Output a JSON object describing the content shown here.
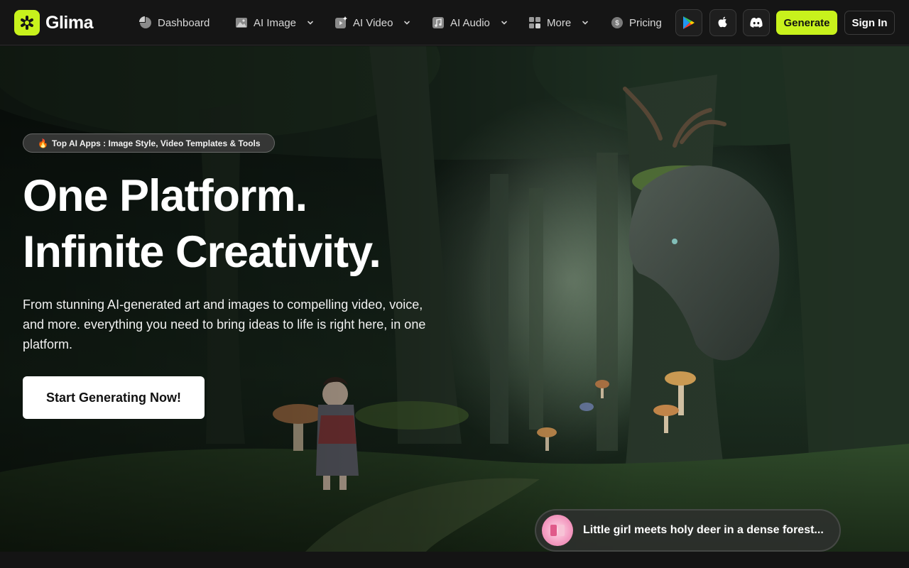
{
  "brand": {
    "name": "Glima",
    "accent": "#c8f21c"
  },
  "nav": {
    "items": [
      {
        "label": "Dashboard",
        "icon": "dashboard-icon",
        "has_dropdown": false
      },
      {
        "label": "AI Image",
        "icon": "image-icon",
        "has_dropdown": true
      },
      {
        "label": "AI Video",
        "icon": "video-icon",
        "has_dropdown": true
      },
      {
        "label": "AI Audio",
        "icon": "audio-icon",
        "has_dropdown": true
      },
      {
        "label": "More",
        "icon": "grid-icon",
        "has_dropdown": true
      },
      {
        "label": "Pricing",
        "icon": "dollar-icon",
        "has_dropdown": false
      }
    ],
    "app_links": [
      "google-play-icon",
      "apple-icon",
      "discord-icon"
    ],
    "generate_label": "Generate",
    "signin_label": "Sign In"
  },
  "hero": {
    "badge_emoji": "🔥",
    "badge_text": "Top AI Apps : Image Style, Video Templates & Tools",
    "headline_line1": "One Platform.",
    "headline_line2": "Infinite Creativity.",
    "subtext": "From stunning AI-generated art and images to compelling video, voice, and more. everything you need to bring ideas to life is right here, in one platform.",
    "cta_label": "Start Generating Now!",
    "prompt_text": "Little girl meets holy deer in a dense forest..."
  }
}
